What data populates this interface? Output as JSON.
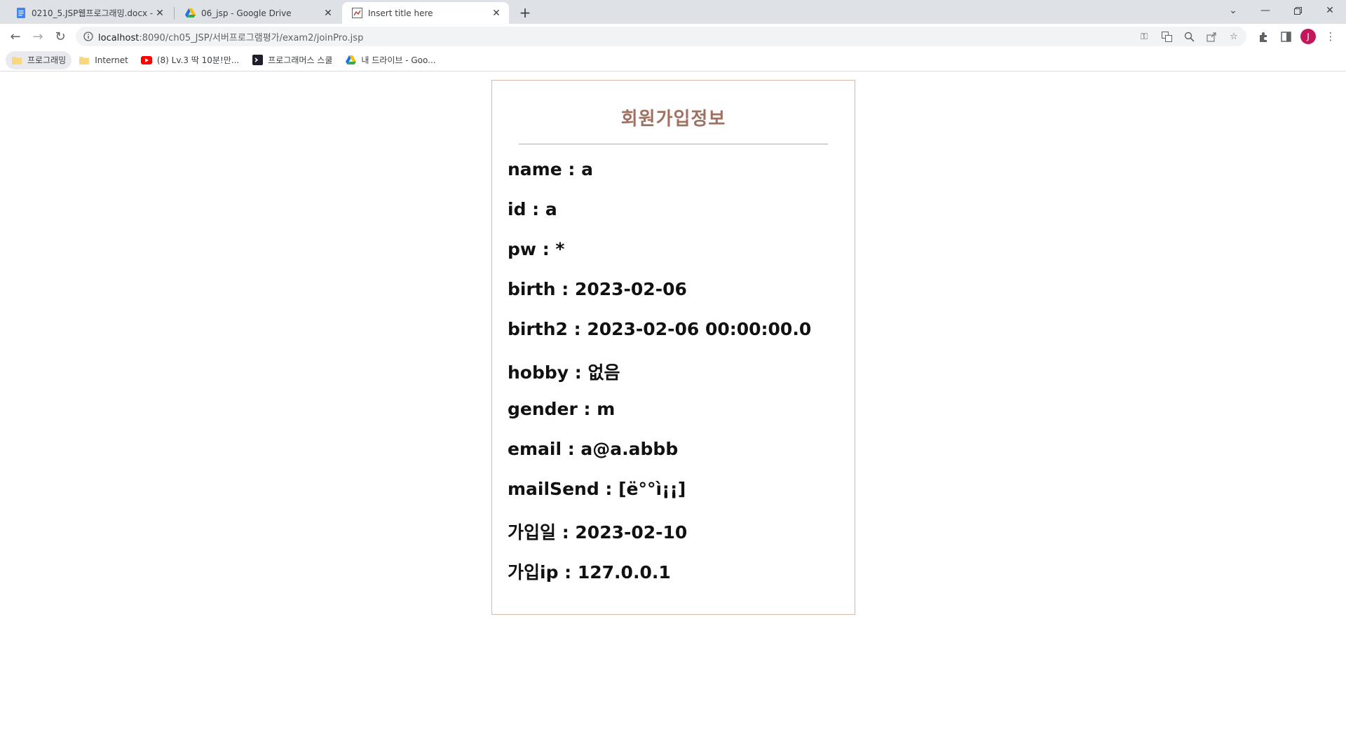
{
  "browser": {
    "tabs": [
      {
        "title": "0210_5.JSP웹프로그래밍.docx - ",
        "icon": "google-docs-icon"
      },
      {
        "title": "06_jsp - Google Drive",
        "icon": "google-drive-icon"
      },
      {
        "title": "Insert title here",
        "icon": "page-icon"
      }
    ],
    "address": {
      "host": "localhost",
      "path": ":8090/ch05_JSP/서버프로그램평가/exam2/joinPro.jsp"
    },
    "profile_initial": "J",
    "bookmarks": [
      {
        "label": "프로그래밍",
        "icon": "folder-icon"
      },
      {
        "label": "Internet",
        "icon": "folder-icon"
      },
      {
        "label": "(8) Lv.3 딱 10분!만...",
        "icon": "youtube-icon"
      },
      {
        "label": "프로그래머스 스쿨",
        "icon": "programmers-icon"
      },
      {
        "label": "내 드라이브 - Goo...",
        "icon": "google-drive-icon"
      }
    ]
  },
  "page": {
    "title": "회원가입정보",
    "fields": [
      "name : a",
      "id : a",
      "pw : *",
      "birth : 2023-02-06",
      "birth2 : 2023-02-06 00:00:00.0",
      "hobby : 없음",
      "gender : m",
      "email : a@a.abbb",
      "mailSend : [ë°°ì¡¡]",
      "가입일 : 2023-02-10",
      "가입ip : 127.0.0.1"
    ]
  },
  "colors": {
    "title": "#a07060",
    "card_border": "#d9b8a8",
    "tabstrip": "#dee1e6",
    "avatar": "#c2185b"
  }
}
